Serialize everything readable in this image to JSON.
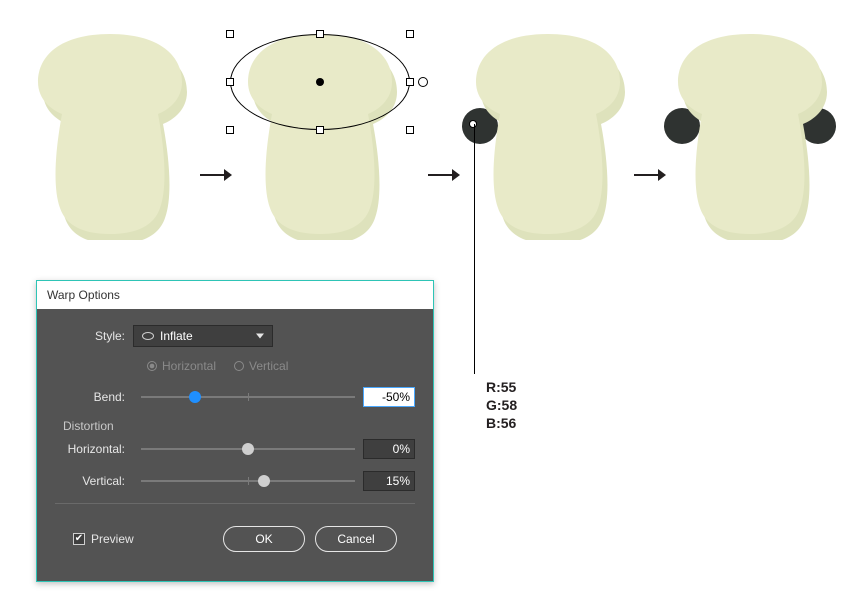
{
  "dialog": {
    "title": "Warp Options",
    "style_label": "Style:",
    "style_value": "Inflate",
    "orient": {
      "horizontal": "Horizontal",
      "vertical": "Vertical",
      "selected": "horizontal"
    },
    "bend": {
      "label": "Bend:",
      "value": "-50%",
      "percent": -50
    },
    "distortion_label": "Distortion",
    "horizontal": {
      "label": "Horizontal:",
      "value": "0%",
      "percent": 0
    },
    "vertical": {
      "label": "Vertical:",
      "value": "15%",
      "percent": 15
    },
    "preview": {
      "label": "Preview",
      "checked": true
    },
    "ok": "OK",
    "cancel": "Cancel"
  },
  "swatch": {
    "r_label": "R:55",
    "g_label": "G:58",
    "b_label": "B:56",
    "hex": "#373A38"
  },
  "shapes": {
    "body_fill": "#E8EAC8",
    "body_shadow": "#DEE2BC",
    "ear_fill": "#2F3331"
  }
}
